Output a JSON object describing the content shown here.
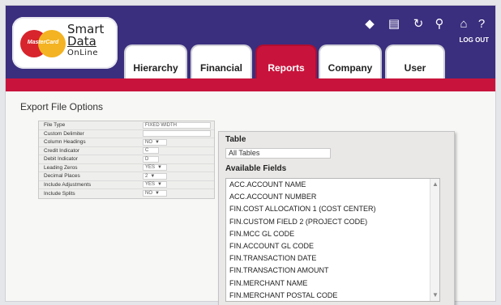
{
  "brand": {
    "card_logo_text": "MasterCard",
    "line1": "Smart",
    "line2": "Data",
    "line3": "OnLine"
  },
  "tabs": [
    {
      "label": "Hierarchy",
      "active": false
    },
    {
      "label": "Financial",
      "active": false
    },
    {
      "label": "Reports",
      "active": true
    },
    {
      "label": "Company",
      "active": false
    },
    {
      "label": "User",
      "active": false
    }
  ],
  "toolbar": {
    "icons": [
      "back-icon",
      "print-icon",
      "refresh-icon",
      "search-icon",
      "home-icon",
      "help-icon"
    ],
    "glyphs": [
      "◆",
      "▤",
      "↻",
      "⚲",
      "⌂",
      "?"
    ],
    "logout_label": "LOG OUT"
  },
  "colors": {
    "header_purple": "#3a2e7e",
    "header_red": "#c8143c",
    "active_tab": "#c8143c"
  },
  "page": {
    "section_title": "Export File Options"
  },
  "options": [
    {
      "label": "File Type",
      "value": "FIXED WIDTH",
      "dropdown": false
    },
    {
      "label": "Custom Delimiter",
      "value": "",
      "dropdown": false
    },
    {
      "label": "Column Headings",
      "value": "NO",
      "dropdown": true
    },
    {
      "label": "Credit Indicator",
      "value": "C",
      "dropdown": false
    },
    {
      "label": "Debit Indicator",
      "value": "D",
      "dropdown": false
    },
    {
      "label": "Leading Zeros",
      "value": "YES",
      "dropdown": true
    },
    {
      "label": "Decimal Places",
      "value": "2",
      "dropdown": true
    },
    {
      "label": "Include Adjustments",
      "value": "YES",
      "dropdown": true
    },
    {
      "label": "Include Splits",
      "value": "NO",
      "dropdown": true
    }
  ],
  "panel": {
    "table_heading": "Table",
    "table_value": "All Tables",
    "fields_heading": "Available Fields",
    "fields": [
      "ACC.ACCOUNT NAME",
      "ACC.ACCOUNT NUMBER",
      "FIN.COST ALLOCATION 1 (COST CENTER)",
      "FIN.CUSTOM FIELD 2 (PROJECT CODE)",
      "FIN.MCC GL CODE",
      "FIN.ACCOUNT GL CODE",
      "FIN.TRANSACTION DATE",
      "FIN.TRANSACTION AMOUNT",
      "FIN.MERCHANT NAME",
      "FIN.MERCHANT POSTAL CODE"
    ]
  }
}
